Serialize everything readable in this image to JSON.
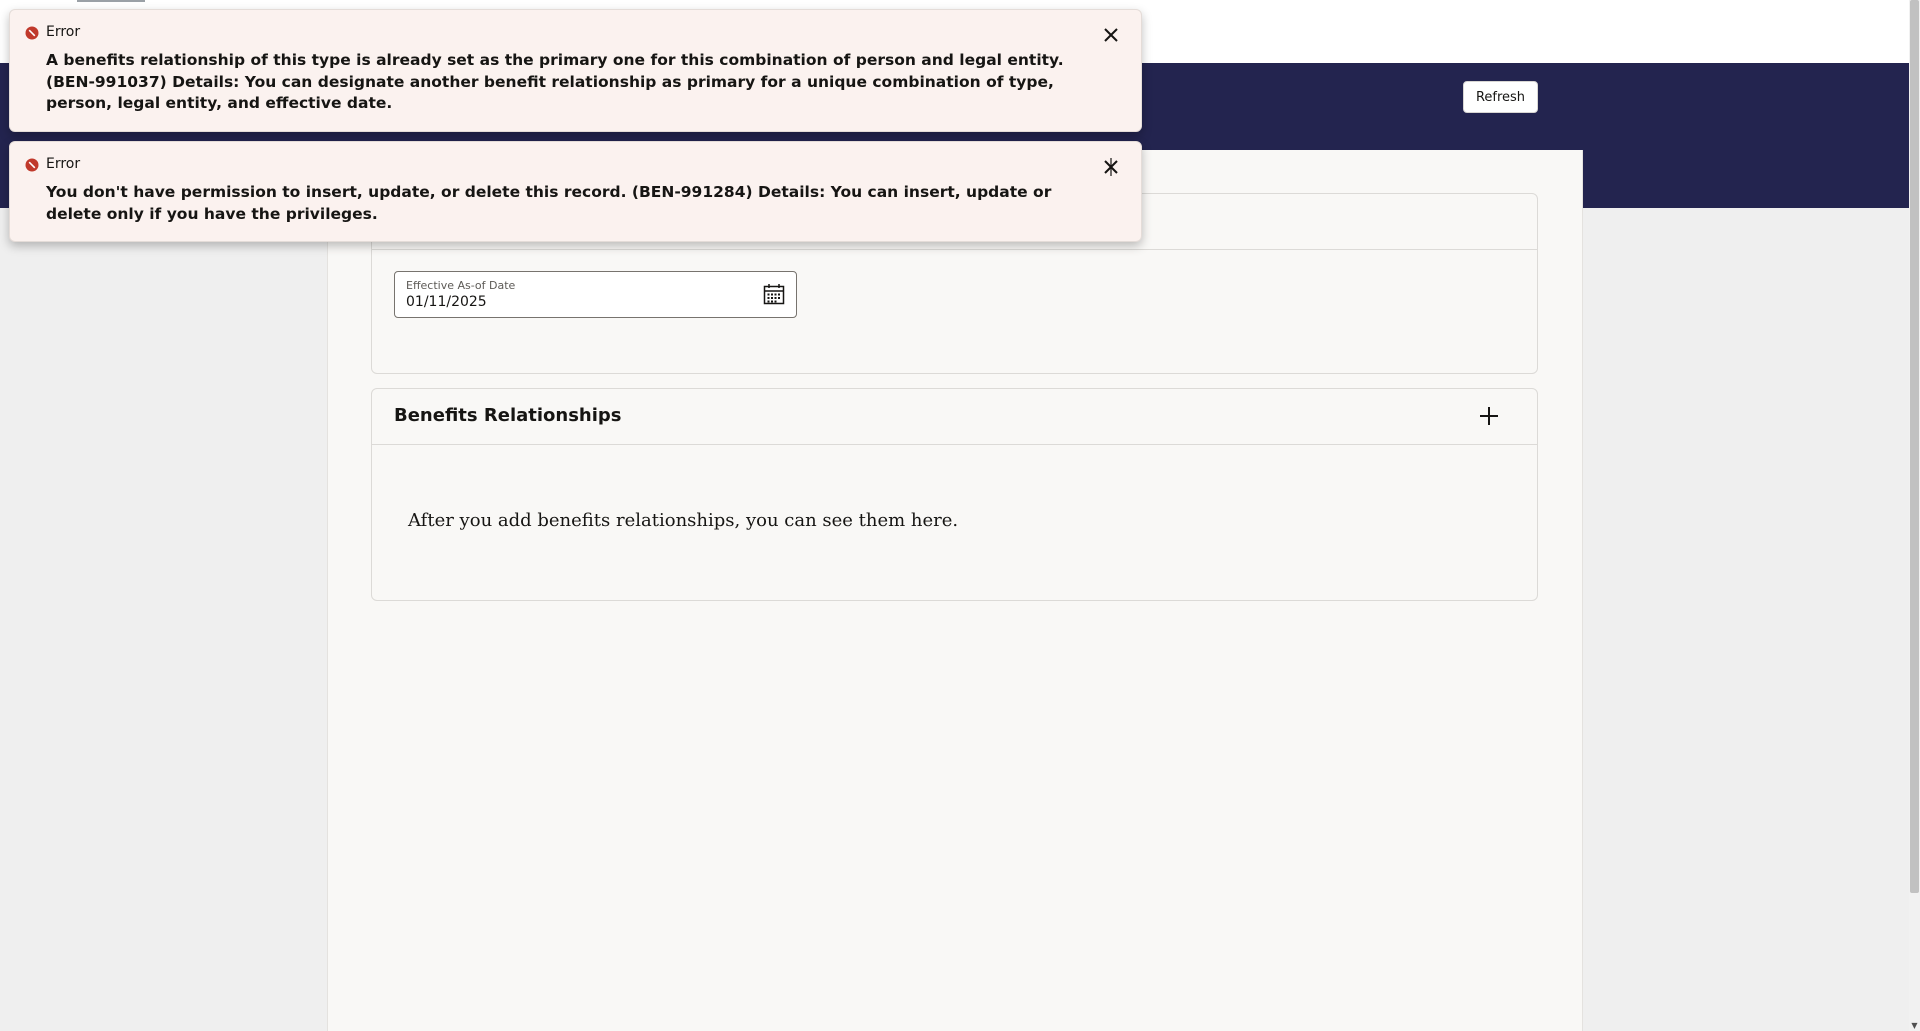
{
  "header": {
    "refresh_label": "Refresh",
    "band_color": "#23244f"
  },
  "effective_date": {
    "label": "Effective As-of Date",
    "value": "01/11/2025",
    "icon": "calendar-icon"
  },
  "benefits_relationships": {
    "title": "Benefits Relationships",
    "add_icon": "plus-icon",
    "empty_message": "After you add benefits relationships, you can see them here."
  },
  "notifications": [
    {
      "title": "Error",
      "message": "A benefits relationship of this type is already set as the primary one for this combination of person and legal entity. (BEN-991037) Details: You can designate another benefit relationship as primary for a unique combination of type, person, legal entity, and effective date.",
      "icon": "error-icon",
      "close_icon": "close-icon"
    },
    {
      "title": "Error",
      "message": "You don't have permission to insert, update, or delete this record. (BEN-991284) Details: You can insert, update or delete only if you have the privileges.",
      "icon": "error-icon",
      "close_icon": "close-icon"
    }
  ],
  "colors": {
    "error_red": "#c0392b",
    "toast_background": "#fbf2ef"
  }
}
